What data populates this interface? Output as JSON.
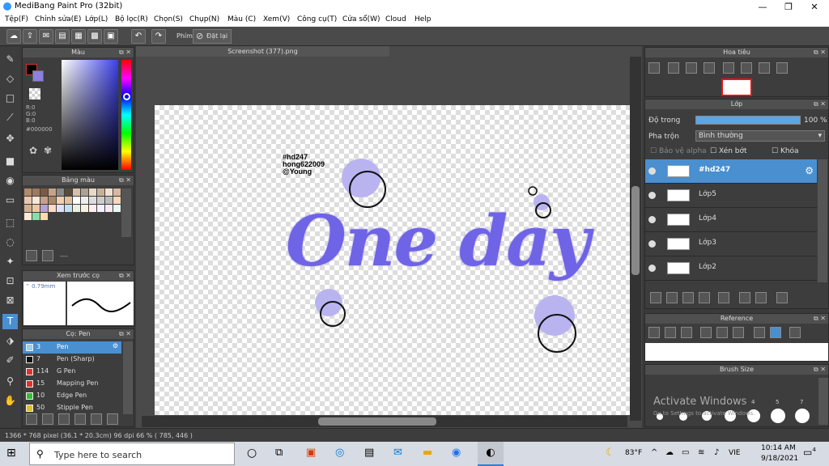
{
  "window": {
    "title": "MediBang Paint Pro (32bit)",
    "min": "—",
    "max": "❐",
    "close": "✕"
  },
  "menu": [
    "Tệp(F)",
    "Chỉnh sửa(E)",
    "Lớp(L)",
    "Bộ lọc(R)",
    "Chọn(S)",
    "Chụp(N)",
    "Màu (C)",
    "Xem(V)",
    "Công cụ(T)",
    "Cửa sổ(W)",
    "Cloud",
    "Help"
  ],
  "toolbar": {
    "phim_label": "Phím",
    "reset_label": "Đặt lại"
  },
  "color_panel": {
    "title": "Màu",
    "r": "R:0",
    "g": "G:0",
    "b": "B:0",
    "hex": "#000000"
  },
  "palette_panel": {
    "title": "Bảng màu",
    "dashes": "---"
  },
  "preview_panel": {
    "title": "Xem trước cọ",
    "size": "0.79mm"
  },
  "brush_panel": {
    "title": "Cọ: Pen",
    "items": [
      {
        "size": "3",
        "name": "Pen",
        "color": "#9ad0f0",
        "selected": true
      },
      {
        "size": "7",
        "name": "Pen (Sharp)",
        "color": "#111111"
      },
      {
        "size": "114",
        "name": "G Pen",
        "color": "#e03030"
      },
      {
        "size": "15",
        "name": "Mapping Pen",
        "color": "#e03030"
      },
      {
        "size": "10",
        "name": "Edge Pen",
        "color": "#30c030"
      },
      {
        "size": "50",
        "name": "Stipple Pen",
        "color": "#e0c020"
      }
    ]
  },
  "canvas": {
    "tab": "Screenshot (377).png",
    "credit": [
      "#hd247",
      "hong622009",
      "@Young"
    ],
    "art_text": "One day"
  },
  "navigator": {
    "title": "Hoa tiêu"
  },
  "layer_panel": {
    "title": "Lớp",
    "opacity_label": "Độ trong",
    "opacity_value": "100 %",
    "blend_label": "Pha trộn",
    "blend_value": "Bình thường",
    "opt_alpha": "Bảo vệ alpha",
    "opt_clip": "Xén bớt",
    "opt_lock": "Khóa",
    "layers": [
      {
        "name": "#hd247",
        "selected": true
      },
      {
        "name": "Lớp5"
      },
      {
        "name": "Lớp4"
      },
      {
        "name": "Lớp3"
      },
      {
        "name": "Lớp2"
      }
    ]
  },
  "reference_panel": {
    "title": "Reference"
  },
  "brushsize_panel": {
    "title": "Brush Size",
    "sizes": [
      "4",
      "5",
      "7"
    ],
    "watermark1": "Activate Windows",
    "watermark2": "Go to Settings to activate Windows."
  },
  "status": {
    "text": "1366 * 768 pixel  (36.1 * 20.3cm)  96 dpi  66 %  ( 785, 446 )"
  },
  "taskbar": {
    "search_placeholder": "Type here to search",
    "weather": "83°F",
    "lang": "VIE",
    "time": "10:14 AM",
    "date": "9/18/2021",
    "notif": "4"
  }
}
